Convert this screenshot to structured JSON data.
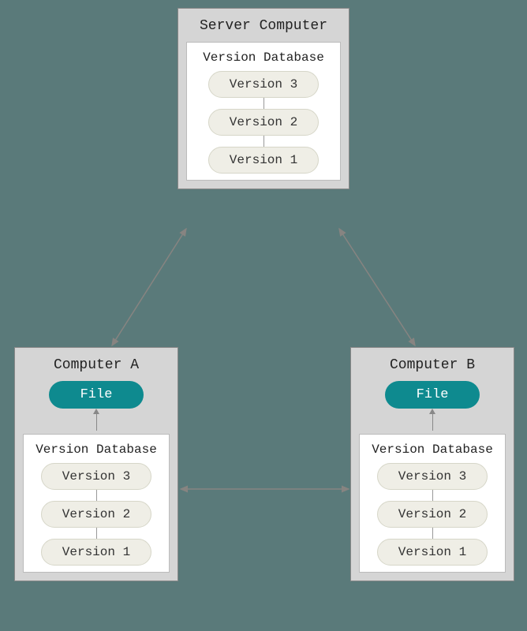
{
  "server": {
    "title": "Server Computer",
    "vdb": {
      "title": "Version Database",
      "versions": [
        "Version 3",
        "Version 2",
        "Version 1"
      ]
    }
  },
  "clientA": {
    "title": "Computer A",
    "file_label": "File",
    "vdb": {
      "title": "Version Database",
      "versions": [
        "Version 3",
        "Version 2",
        "Version 1"
      ]
    }
  },
  "clientB": {
    "title": "Computer B",
    "file_label": "File",
    "vdb": {
      "title": "Version Database",
      "versions": [
        "Version 3",
        "Version 2",
        "Version 1"
      ]
    }
  }
}
